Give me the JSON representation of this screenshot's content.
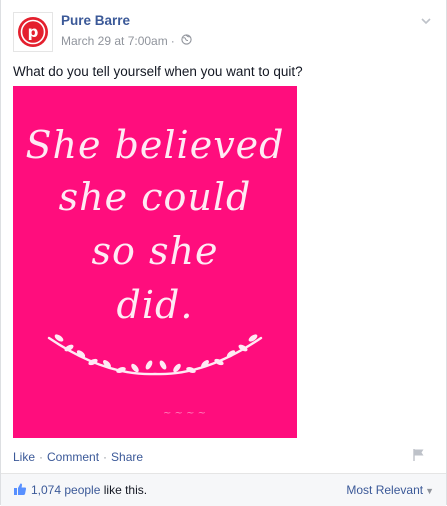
{
  "post": {
    "page_name": "Pure Barre",
    "date": "March 29 at 7:00am",
    "dot": "·",
    "message": "What do you tell yourself when you want to quit?",
    "image_quote": [
      "She believed",
      "she could",
      "so she",
      "did."
    ],
    "logo_letter": "p"
  },
  "actions": {
    "like": "Like",
    "comment": "Comment",
    "share": "Share",
    "sep": "·"
  },
  "likes": {
    "count_link": "1,074 people",
    "suffix": " like this.",
    "sort_label": "Most Relevant"
  },
  "icons": {
    "avatar": "pure-barre-logo",
    "privacy": "globe-icon",
    "menu": "chevron-down-icon",
    "report": "flag-icon",
    "like": "thumbs-up-icon"
  },
  "colors": {
    "brand_link": "#3b5998",
    "photo_bg": "#ff0d7d",
    "logo_red": "#e4202e"
  }
}
